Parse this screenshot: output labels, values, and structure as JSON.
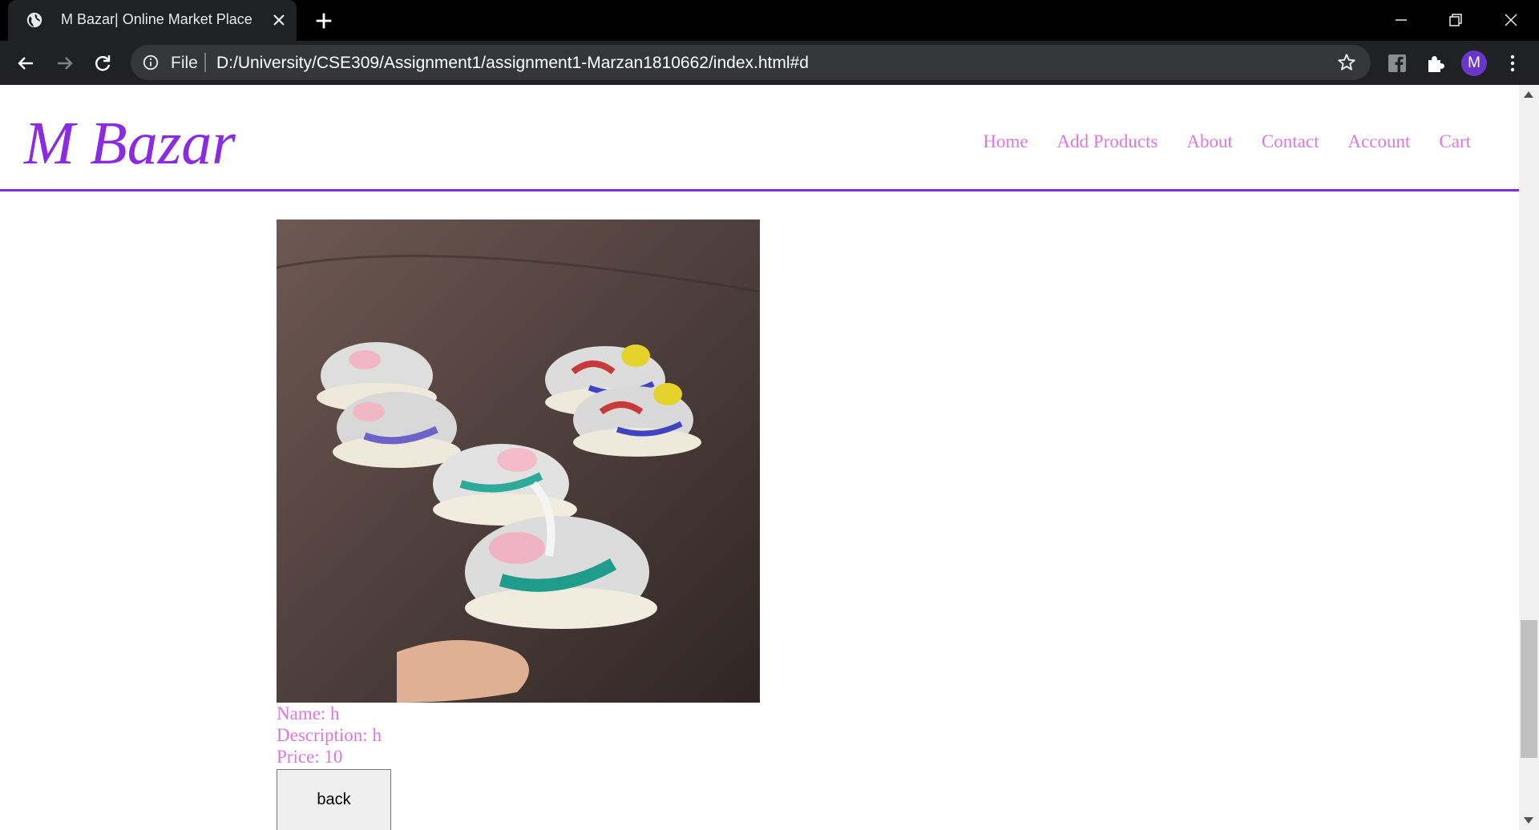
{
  "browser": {
    "tab_title": "M Bazar| Online Market Place",
    "file_label": "File",
    "url": "D:/University/CSE309/Assignment1/assignment1-Marzan1810662/index.html#d",
    "profile_initial": "M"
  },
  "site": {
    "logo": "M Bazar",
    "nav": [
      "Home",
      "Add Products",
      "About",
      "Contact",
      "Account",
      "Cart"
    ],
    "accent_color": "#8a2be2",
    "link_color": "#dd77dd"
  },
  "product": {
    "image_alt": "Kids sneakers",
    "name_line": "Name: h",
    "description_line": "Description: h",
    "price_line": "Price: 10",
    "back_label": "back"
  }
}
